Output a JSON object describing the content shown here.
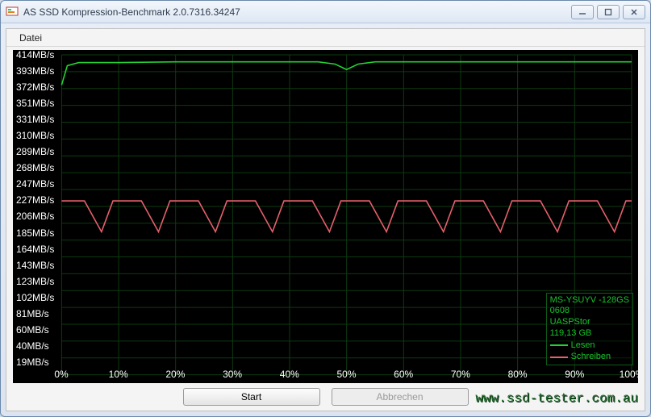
{
  "window": {
    "title": "AS SSD Kompression-Benchmark 2.0.7316.34247"
  },
  "menu": {
    "datei": "Datei"
  },
  "buttons": {
    "start": "Start",
    "abort": "Abbrechen"
  },
  "legend": {
    "device": "MS-YSUYV -128GS",
    "fw": "0608",
    "driver": "UASPStor",
    "capacity": "119,13 GB",
    "read": "Lesen",
    "write": "Schreiben"
  },
  "colors": {
    "read": "#25d033",
    "write": "#e5606c",
    "grid": "#0d3a10"
  },
  "watermark": "www.ssd-tester.com.au",
  "chart_data": {
    "type": "line",
    "xlabel": "",
    "ylabel": "",
    "ylim": [
      0,
      414
    ],
    "y_ticks": [
      "414MB/s",
      "393MB/s",
      "372MB/s",
      "351MB/s",
      "331MB/s",
      "310MB/s",
      "289MB/s",
      "268MB/s",
      "247MB/s",
      "227MB/s",
      "206MB/s",
      "185MB/s",
      "164MB/s",
      "143MB/s",
      "123MB/s",
      "102MB/s",
      "81MB/s",
      "60MB/s",
      "40MB/s",
      "19MB/s"
    ],
    "x_ticks": [
      "0%",
      "10%",
      "20%",
      "30%",
      "40%",
      "50%",
      "60%",
      "70%",
      "80%",
      "90%",
      "100%"
    ],
    "series": [
      {
        "name": "Lesen",
        "color": "#25d033",
        "x": [
          0,
          1,
          3,
          10,
          20,
          30,
          40,
          45,
          48,
          50,
          52,
          55,
          60,
          70,
          80,
          90,
          100
        ],
        "y": [
          375,
          400,
          404,
          404,
          405,
          405,
          405,
          405,
          402,
          395,
          402,
          405,
          405,
          405,
          405,
          405,
          405
        ]
      },
      {
        "name": "Schreiben",
        "color": "#e5606c",
        "x": [
          0,
          2,
          4,
          7,
          9,
          10,
          12,
          14,
          17,
          19,
          20,
          22,
          24,
          27,
          29,
          30,
          32,
          34,
          37,
          39,
          40,
          42,
          44,
          47,
          49,
          50,
          52,
          54,
          57,
          59,
          60,
          62,
          64,
          67,
          69,
          70,
          72,
          74,
          77,
          79,
          80,
          82,
          84,
          87,
          89,
          90,
          92,
          94,
          97,
          99,
          100
        ],
        "y": [
          225,
          225,
          225,
          185,
          225,
          225,
          225,
          225,
          185,
          225,
          225,
          225,
          225,
          185,
          225,
          225,
          225,
          225,
          185,
          225,
          225,
          225,
          225,
          185,
          225,
          225,
          225,
          225,
          185,
          225,
          225,
          225,
          225,
          185,
          225,
          225,
          225,
          225,
          185,
          225,
          225,
          225,
          225,
          185,
          225,
          225,
          225,
          225,
          185,
          225,
          225
        ]
      }
    ]
  }
}
